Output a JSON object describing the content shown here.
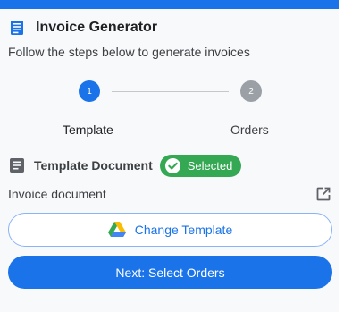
{
  "header": {
    "title": "Invoice Generator",
    "icon": "invoice-doc-icon"
  },
  "subtitle": "Follow the steps below to generate invoices",
  "stepper": {
    "steps": [
      {
        "number": "1",
        "label": "Template",
        "state": "active"
      },
      {
        "number": "2",
        "label": "Orders",
        "state": "inactive"
      }
    ]
  },
  "template_section": {
    "title": "Template Document",
    "badge": "Selected",
    "document_label": "Invoice document"
  },
  "buttons": {
    "change_template": "Change Template",
    "next": "Next: Select Orders"
  },
  "colors": {
    "accent": "#1a73e8",
    "success": "#34a853",
    "inactive_step": "#9aa0a6"
  }
}
